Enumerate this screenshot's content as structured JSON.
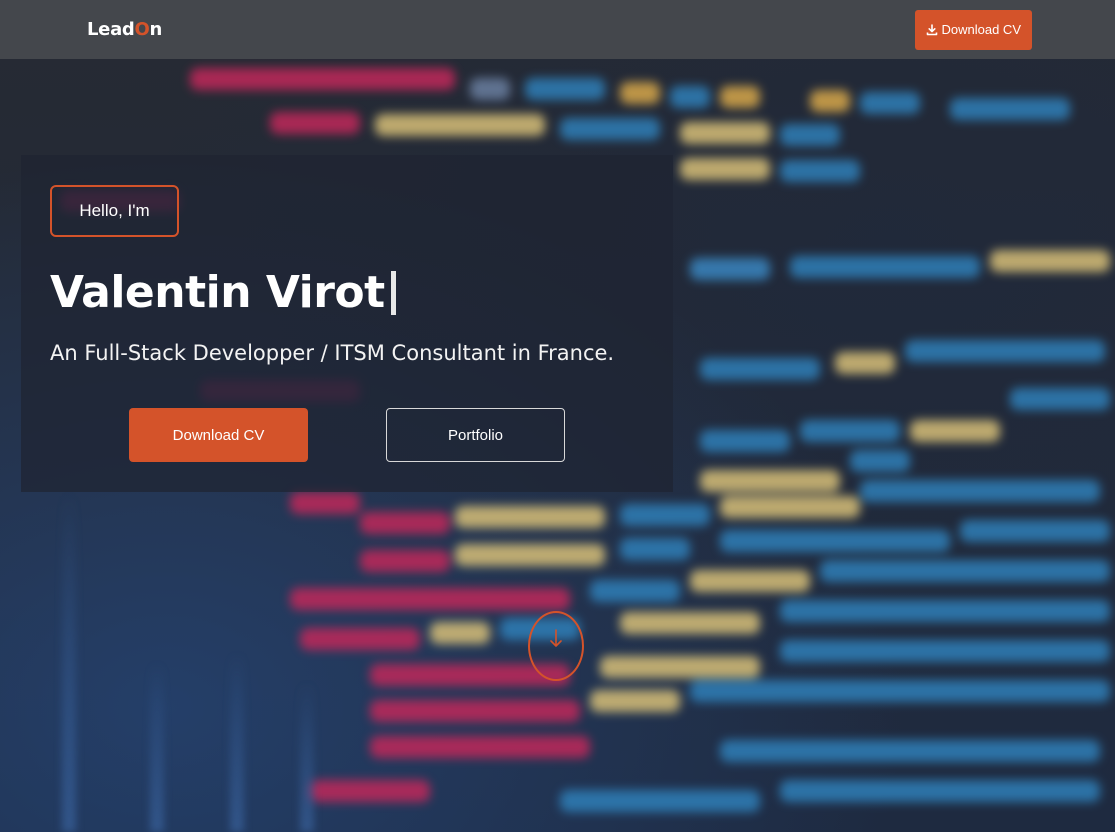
{
  "navbar": {
    "logo_pre": "Lead",
    "logo_accent": "O",
    "logo_post": "n",
    "cta_label": "Download CV",
    "cta_icon": "download-icon"
  },
  "hero": {
    "greeting": "Hello, I'm",
    "name": "Valentin Virot",
    "tagline": "An Full-Stack Developper / ITSM Consultant in France.",
    "primary_button": "Download CV",
    "secondary_button": "Portfolio"
  },
  "scroll": {
    "icon": "arrow-down-icon"
  },
  "colors": {
    "accent": "#d4532a",
    "navbar": "#44474c",
    "background": "#1b2433"
  }
}
